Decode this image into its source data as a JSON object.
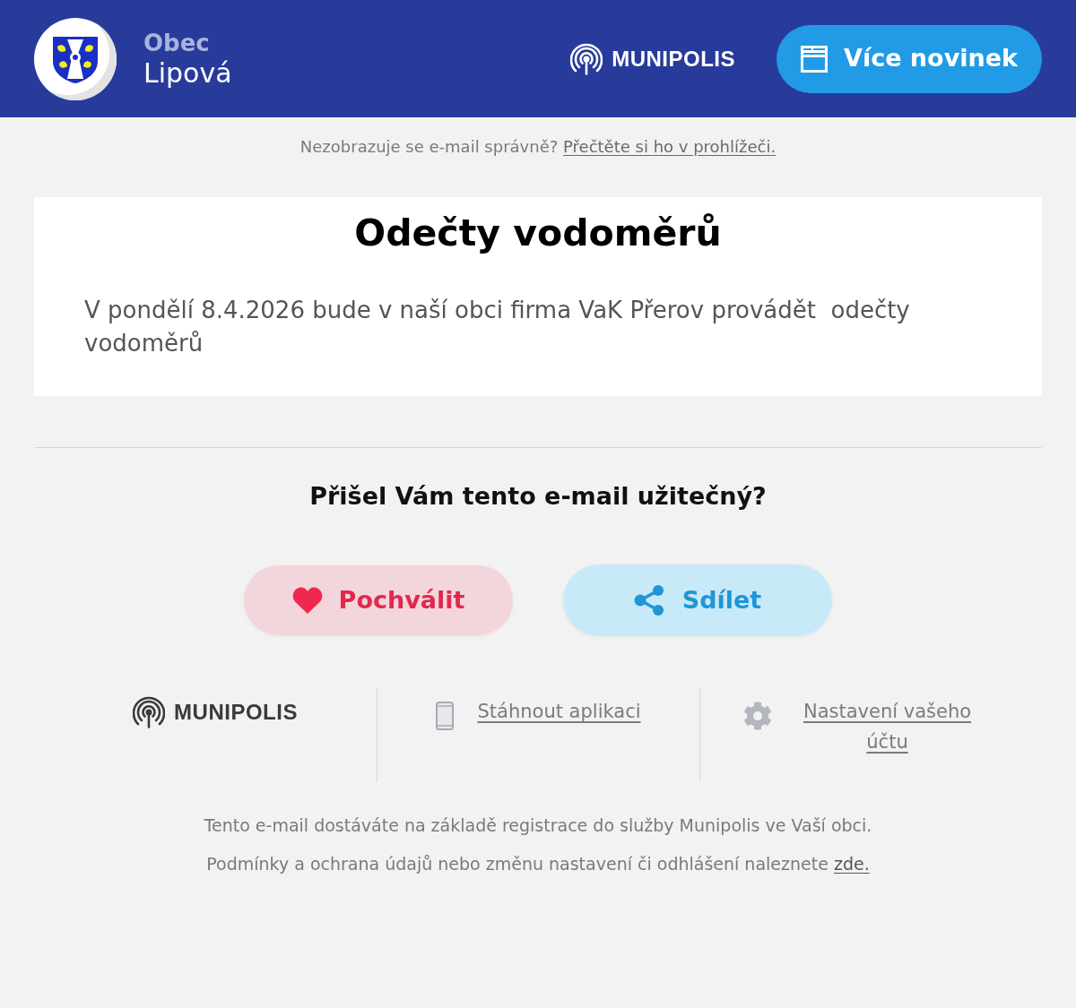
{
  "header": {
    "logo_title": "Obec",
    "logo_subtitle": "Lipová",
    "brand": "MUNIPOLIS",
    "more_news_button": "Více novinek"
  },
  "browser_notice": {
    "text": "Nezobrazuje se e-mail správně?",
    "link": "Přečtěte si ho v prohlížeči."
  },
  "article": {
    "title": "Odečty vodoměrů",
    "body": "V pondělí 8.4.2026 bude v naší obci firma VaK Přerov provádět  odečty vodoměrů"
  },
  "feedback": {
    "question": "Přišel Vám tento e-mail užitečný?",
    "buttons": [
      {
        "kind": "praise",
        "label": "Pochválit"
      },
      {
        "kind": "share",
        "label": "Sdílet"
      }
    ]
  },
  "footer_links": [
    {
      "kind": "brand",
      "label": "MUNIPOLIS"
    },
    {
      "kind": "app",
      "label": "Stáhnout aplikaci"
    },
    {
      "kind": "settings",
      "label": "Nastavení vašeho účtu"
    }
  ],
  "footer_notes": [
    {
      "text": "Tento e-mail dostáváte na základě registrace do služby Munipolis ve Vaší obci."
    },
    {
      "text": "Podmínky a ochrana údajů nebo změnu nastavení či odhlášení naleznete",
      "link": "zde."
    }
  ]
}
